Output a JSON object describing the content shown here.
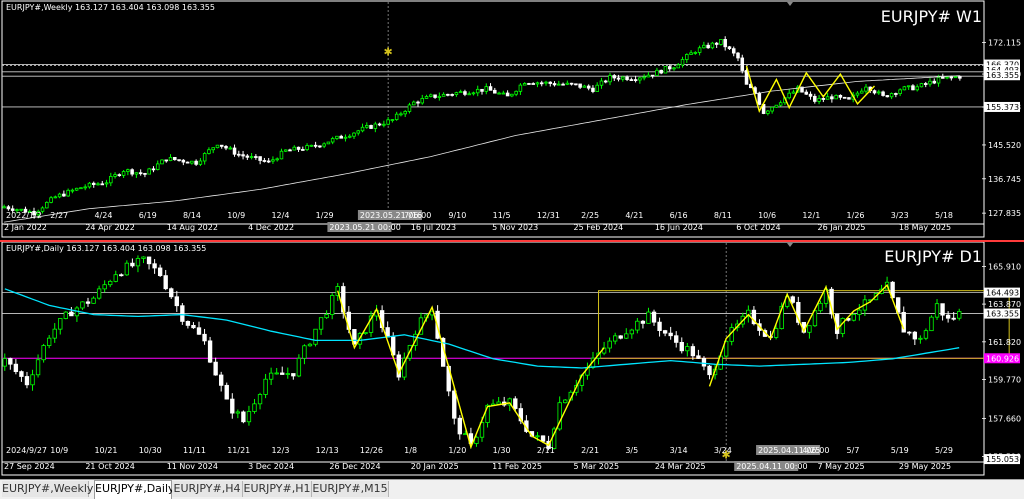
{
  "colors": {
    "bg": "#000000",
    "bull": "#00ff00",
    "bear": "#ffffff",
    "ma_w": "#e8e8e8",
    "ma_d": "#00e5ff",
    "zigzag": "#ffff00",
    "box": "#d4c21c",
    "magenta_line": "#ff00ff",
    "separator": "#ff3b3b"
  },
  "chart_data": [
    {
      "type": "candlestick",
      "title": "EURJPY# W1",
      "info": "EURJPY#,Weekly  163.127 163.404 163.098 163.355",
      "ylim": [
        124.5,
        180.0
      ],
      "yticks": [
        "172.115",
        "163.910",
        "155.373",
        "145.520",
        "136.745",
        "127.835"
      ],
      "price_labels": [
        {
          "value": "166.370",
          "y": 166.37,
          "bg": "#ffffff"
        },
        {
          "value": "164.493",
          "y": 164.9,
          "bg": "#ffffff"
        },
        {
          "value": "163.355",
          "y": 163.6,
          "bg": "#ffffff"
        },
        {
          "value": "155.373",
          "y": 155.373,
          "bg": "#ffffff"
        }
      ],
      "hlines": [
        166.37,
        164.493,
        163.355,
        155.373
      ],
      "xticks": [
        "2022/1/2",
        "2/27",
        "4/24",
        "6/19",
        "8/14",
        "10/9",
        "12/4",
        "1/29",
        "2023.05.21 06:00",
        "7/16",
        "9/10",
        "11/5",
        "12/31",
        "2/25",
        "4/21",
        "6/16",
        "8/11",
        "10/6",
        "12/1",
        "1/26",
        "3/23",
        "5/18"
      ],
      "xdates": [
        "2 Jan 2022",
        "24 Apr 2022",
        "14 Aug 2022",
        "4 Dec 2022",
        "2023.05.21 00:00",
        "16 Jul 2023",
        "5 Nov 2023",
        "25 Feb 2024",
        "16 Jun 2024",
        "6 Oct 2024",
        "26 Jan 2025",
        "18 May 2025"
      ],
      "closes_anchor": [
        [
          0,
          129.5
        ],
        [
          7,
          128
        ],
        [
          12,
          132
        ],
        [
          18,
          134.5
        ],
        [
          24,
          136
        ],
        [
          28,
          139
        ],
        [
          33,
          138
        ],
        [
          38,
          142
        ],
        [
          45,
          141
        ],
        [
          50,
          146
        ],
        [
          55,
          143
        ],
        [
          62,
          141
        ],
        [
          66,
          144
        ],
        [
          72,
          145
        ],
        [
          80,
          148
        ],
        [
          85,
          150
        ],
        [
          91,
          152
        ],
        [
          96,
          156.5
        ],
        [
          100,
          158
        ],
        [
          106,
          159
        ],
        [
          113,
          160
        ],
        [
          118,
          158
        ],
        [
          122,
          162
        ],
        [
          128,
          161.5
        ],
        [
          134,
          161
        ],
        [
          138,
          160
        ],
        [
          142,
          163
        ],
        [
          148,
          163
        ],
        [
          152,
          164
        ],
        [
          157,
          166
        ],
        [
          162,
          170
        ],
        [
          168,
          172.3
        ],
        [
          172,
          168
        ],
        [
          174,
          161
        ],
        [
          176,
          159
        ],
        [
          178,
          154
        ],
        [
          182,
          157
        ],
        [
          186,
          160
        ],
        [
          190,
          157
        ],
        [
          194,
          158
        ],
        [
          198,
          157
        ],
        [
          202,
          161
        ],
        [
          206,
          158
        ],
        [
          210,
          160
        ],
        [
          214,
          160.5
        ],
        [
          219,
          162.5
        ],
        [
          224,
          163.3
        ]
      ],
      "ma_anchor": [
        [
          0,
          125.5
        ],
        [
          20,
          129
        ],
        [
          40,
          131
        ],
        [
          60,
          134
        ],
        [
          80,
          138
        ],
        [
          100,
          142.5
        ],
        [
          120,
          148
        ],
        [
          140,
          152
        ],
        [
          160,
          156
        ],
        [
          180,
          159.5
        ],
        [
          200,
          162
        ],
        [
          224,
          163.5
        ]
      ],
      "zigzag": [
        [
          174,
          166
        ],
        [
          177,
          154.3
        ],
        [
          181,
          162.5
        ],
        [
          184,
          155.2
        ],
        [
          188,
          164.2
        ],
        [
          192,
          158
        ],
        [
          196,
          163.9
        ],
        [
          200,
          156.2
        ],
        [
          204,
          160.8
        ]
      ],
      "marker": {
        "label": "✱",
        "date_idx": 90,
        "value": 169.8
      }
    },
    {
      "type": "candlestick",
      "title": "EURJPY# D1",
      "info": "EURJPY#,Daily  163.127 163.404 163.098 163.355",
      "ylim": [
        155.4,
        166.7
      ],
      "yticks": [
        "165.910",
        "163.870",
        "161.820",
        "159.770",
        "157.660",
        "155.590"
      ],
      "price_labels": [
        {
          "value": "164.493",
          "y": 164.493,
          "bg": "#ffffff"
        },
        {
          "value": "163.355",
          "y": 163.355,
          "bg": "#ffffff"
        },
        {
          "value": "160.926",
          "y": 160.926,
          "bg": "#ff00ff"
        },
        {
          "value": "155.053",
          "y": 155.45,
          "bg": "#ffffff"
        }
      ],
      "hlines": [
        164.493,
        163.355
      ],
      "magenta_hline": 160.926,
      "box": {
        "x0": 107,
        "x1": 181,
        "y0": 160.926,
        "y1": 164.6
      },
      "xticks": [
        "2024/9/27",
        "10/9",
        "10/21",
        "10/30",
        "11/11",
        "11/21",
        "12/3",
        "12/13",
        "12/26",
        "1/8",
        "1/20",
        "1/30",
        "2/11",
        "2/21",
        "3/5",
        "3/14",
        "3/24",
        "2025.04.11 06:00",
        "4/25",
        "5/7",
        "5/19",
        "5/29"
      ],
      "xdates": [
        "27 Sep 2024",
        "21 Oct 2024",
        "11 Nov 2024",
        "3 Dec 2024",
        "26 Dec 2024",
        "20 Jan 2025",
        "11 Feb 2025",
        "5 Mar 2025",
        "24 Mar 2025",
        "2025.04.11 00:00",
        "7 May 2025",
        "29 May 2025"
      ],
      "closes_anchor": [
        [
          0,
          160.8
        ],
        [
          4,
          159.6
        ],
        [
          8,
          162.2
        ],
        [
          12,
          163.5
        ],
        [
          16,
          164.2
        ],
        [
          20,
          165.6
        ],
        [
          25,
          166.2
        ],
        [
          28,
          165.5
        ],
        [
          32,
          163.2
        ],
        [
          36,
          161.8
        ],
        [
          40,
          158.5
        ],
        [
          43,
          157.5
        ],
        [
          47,
          159.8
        ],
        [
          52,
          160.2
        ],
        [
          56,
          162.5
        ],
        [
          60,
          164.6
        ],
        [
          63,
          161.5
        ],
        [
          67,
          163.6
        ],
        [
          71,
          160.1
        ],
        [
          74,
          162.5
        ],
        [
          77,
          163.7
        ],
        [
          81,
          157.5
        ],
        [
          84,
          156.1
        ],
        [
          87,
          158.3
        ],
        [
          91,
          158.5
        ],
        [
          95,
          156.7
        ],
        [
          98,
          156.2
        ],
        [
          100,
          158.5
        ],
        [
          104,
          160.0
        ],
        [
          108,
          161.5
        ],
        [
          112,
          162.5
        ],
        [
          116,
          163.2
        ],
        [
          120,
          162.0
        ],
        [
          124,
          161.2
        ],
        [
          127,
          159.9
        ],
        [
          130,
          162.0
        ],
        [
          134,
          163.3
        ],
        [
          138,
          162.0
        ],
        [
          141,
          164.4
        ],
        [
          144,
          162.4
        ],
        [
          148,
          164.6
        ],
        [
          150,
          162.5
        ],
        [
          153,
          163.5
        ],
        [
          156,
          164.0
        ],
        [
          159,
          164.8
        ],
        [
          162,
          162.5
        ],
        [
          165,
          161.9
        ],
        [
          168,
          163.8
        ],
        [
          170,
          163.0
        ],
        [
          172,
          163.36
        ]
      ],
      "ma_anchor": [
        [
          0,
          164.7
        ],
        [
          8,
          163.8
        ],
        [
          16,
          163.3
        ],
        [
          24,
          163.2
        ],
        [
          32,
          163.3
        ],
        [
          40,
          163.0
        ],
        [
          48,
          162.4
        ],
        [
          56,
          161.9
        ],
        [
          64,
          161.9
        ],
        [
          72,
          162.2
        ],
        [
          80,
          161.7
        ],
        [
          88,
          160.9
        ],
        [
          96,
          160.5
        ],
        [
          104,
          160.4
        ],
        [
          112,
          160.6
        ],
        [
          120,
          160.8
        ],
        [
          128,
          160.6
        ],
        [
          136,
          160.5
        ],
        [
          144,
          160.6
        ],
        [
          152,
          160.7
        ],
        [
          160,
          160.9
        ],
        [
          166,
          161.2
        ],
        [
          172,
          161.5
        ]
      ],
      "zigzag": [
        [
          60,
          164.6
        ],
        [
          63,
          161.5
        ],
        [
          67,
          163.6
        ],
        [
          71,
          160.1
        ],
        [
          77,
          163.7
        ],
        [
          84,
          156.1
        ],
        [
          87,
          158.3
        ],
        [
          91,
          158.5
        ],
        [
          95,
          156.7
        ],
        [
          98,
          156.2
        ],
        [
          104,
          160.0
        ],
        [
          108,
          161.5
        ]
      ],
      "zigzag2": [
        [
          127,
          159.4
        ],
        [
          130,
          162.0
        ],
        [
          134,
          163.3
        ],
        [
          138,
          162.0
        ],
        [
          141,
          164.4
        ],
        [
          144,
          162.4
        ],
        [
          148,
          164.8
        ],
        [
          150,
          162.5
        ],
        [
          153,
          163.5
        ],
        [
          156,
          164.0
        ],
        [
          159,
          164.9
        ],
        [
          162,
          162.5
        ]
      ],
      "marker": {
        "label": "✱",
        "date_idx": 130,
        "value": 155.7
      }
    }
  ],
  "tabs": [
    {
      "label": "EURJPY#,Weekly"
    },
    {
      "label": "EURJPY#,Daily"
    },
    {
      "label": "EURJPY#,H4"
    },
    {
      "label": "EURJPY#,H1"
    },
    {
      "label": "EURJPY#,M15"
    }
  ]
}
